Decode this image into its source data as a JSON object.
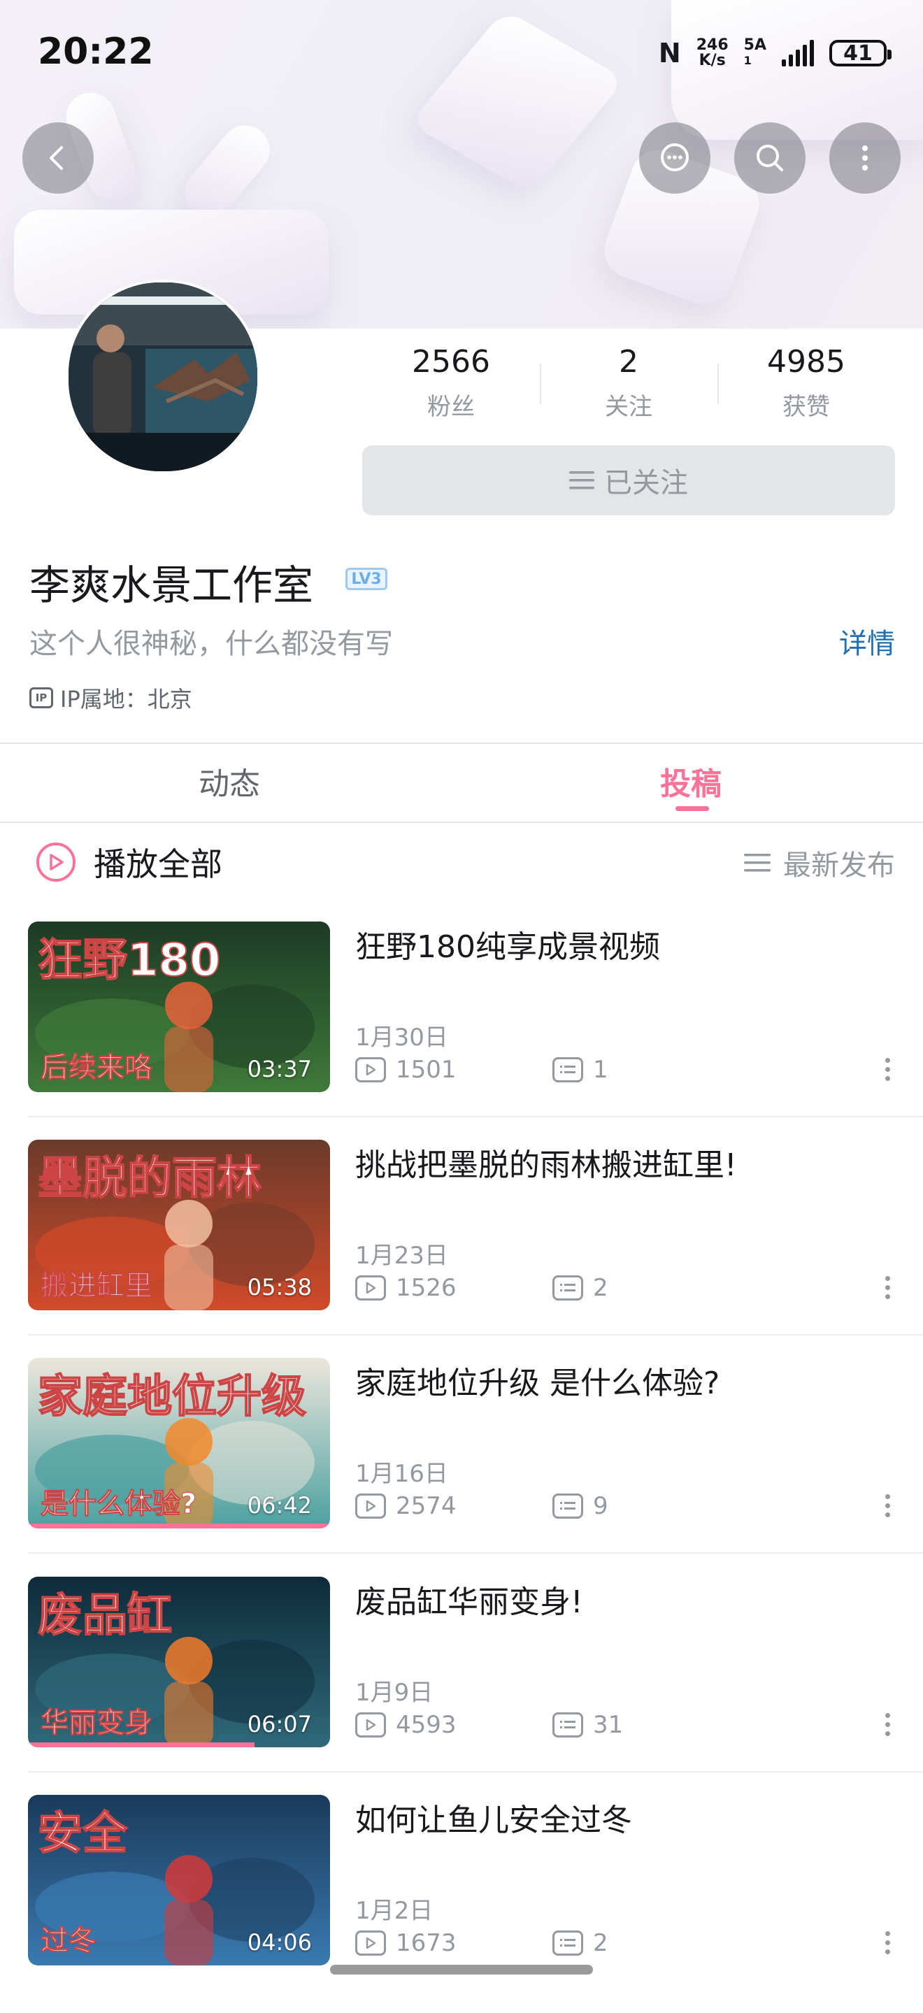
{
  "status_bar": {
    "time": "20:22",
    "nfc": "N",
    "net_speed_value": "246",
    "net_speed_unit": "K/s",
    "network": "5A",
    "network_sub": "1",
    "battery": "41"
  },
  "profile": {
    "stats": [
      {
        "value": "2566",
        "label": "粉丝"
      },
      {
        "value": "2",
        "label": "关注"
      },
      {
        "value": "4985",
        "label": "获赞"
      }
    ],
    "follow_button": "已关注",
    "name": "李爽水景工作室",
    "level_badge": "LV3",
    "bio": "这个人很神秘，什么都没有写",
    "detail_link": "详情",
    "ip_icon": "IP",
    "ip_location": "IP属地：北京"
  },
  "tabs": {
    "dynamic": "动态",
    "submissions": "投稿"
  },
  "list_header": {
    "play_all": "播放全部",
    "sort": "最新发布"
  },
  "videos": [
    {
      "title": "狂野180纯享成景视频",
      "date": "1月30日",
      "plays": "1501",
      "comments": "1",
      "duration": "03:37",
      "thumb_text": "狂野180",
      "thumb_sub": "后续来咯",
      "watched": 0
    },
    {
      "title": "挑战把墨脱的雨林搬进缸里!",
      "date": "1月23日",
      "plays": "1526",
      "comments": "2",
      "duration": "05:38",
      "thumb_text": "墨脱的雨林",
      "thumb_sub": "搬进缸里",
      "watched": 0
    },
    {
      "title": "家庭地位升级 是什么体验?",
      "date": "1月16日",
      "plays": "2574",
      "comments": "9",
      "duration": "06:42",
      "thumb_text": "家庭地位升级",
      "thumb_sub": "是什么体验?",
      "watched": 1.0
    },
    {
      "title": "废品缸华丽变身!",
      "date": "1月9日",
      "plays": "4593",
      "comments": "31",
      "duration": "06:07",
      "thumb_text": "废品缸",
      "thumb_sub": "华丽变身",
      "watched": 0.75
    },
    {
      "title": "如何让鱼儿安全过冬",
      "date": "1月2日",
      "plays": "1673",
      "comments": "2",
      "duration": "04:06",
      "thumb_text": "安全",
      "thumb_sub": "过冬",
      "watched": 0
    }
  ],
  "colors": {
    "accent": "#fb7299",
    "link": "#1f6fb2",
    "muted": "#9499a0"
  }
}
